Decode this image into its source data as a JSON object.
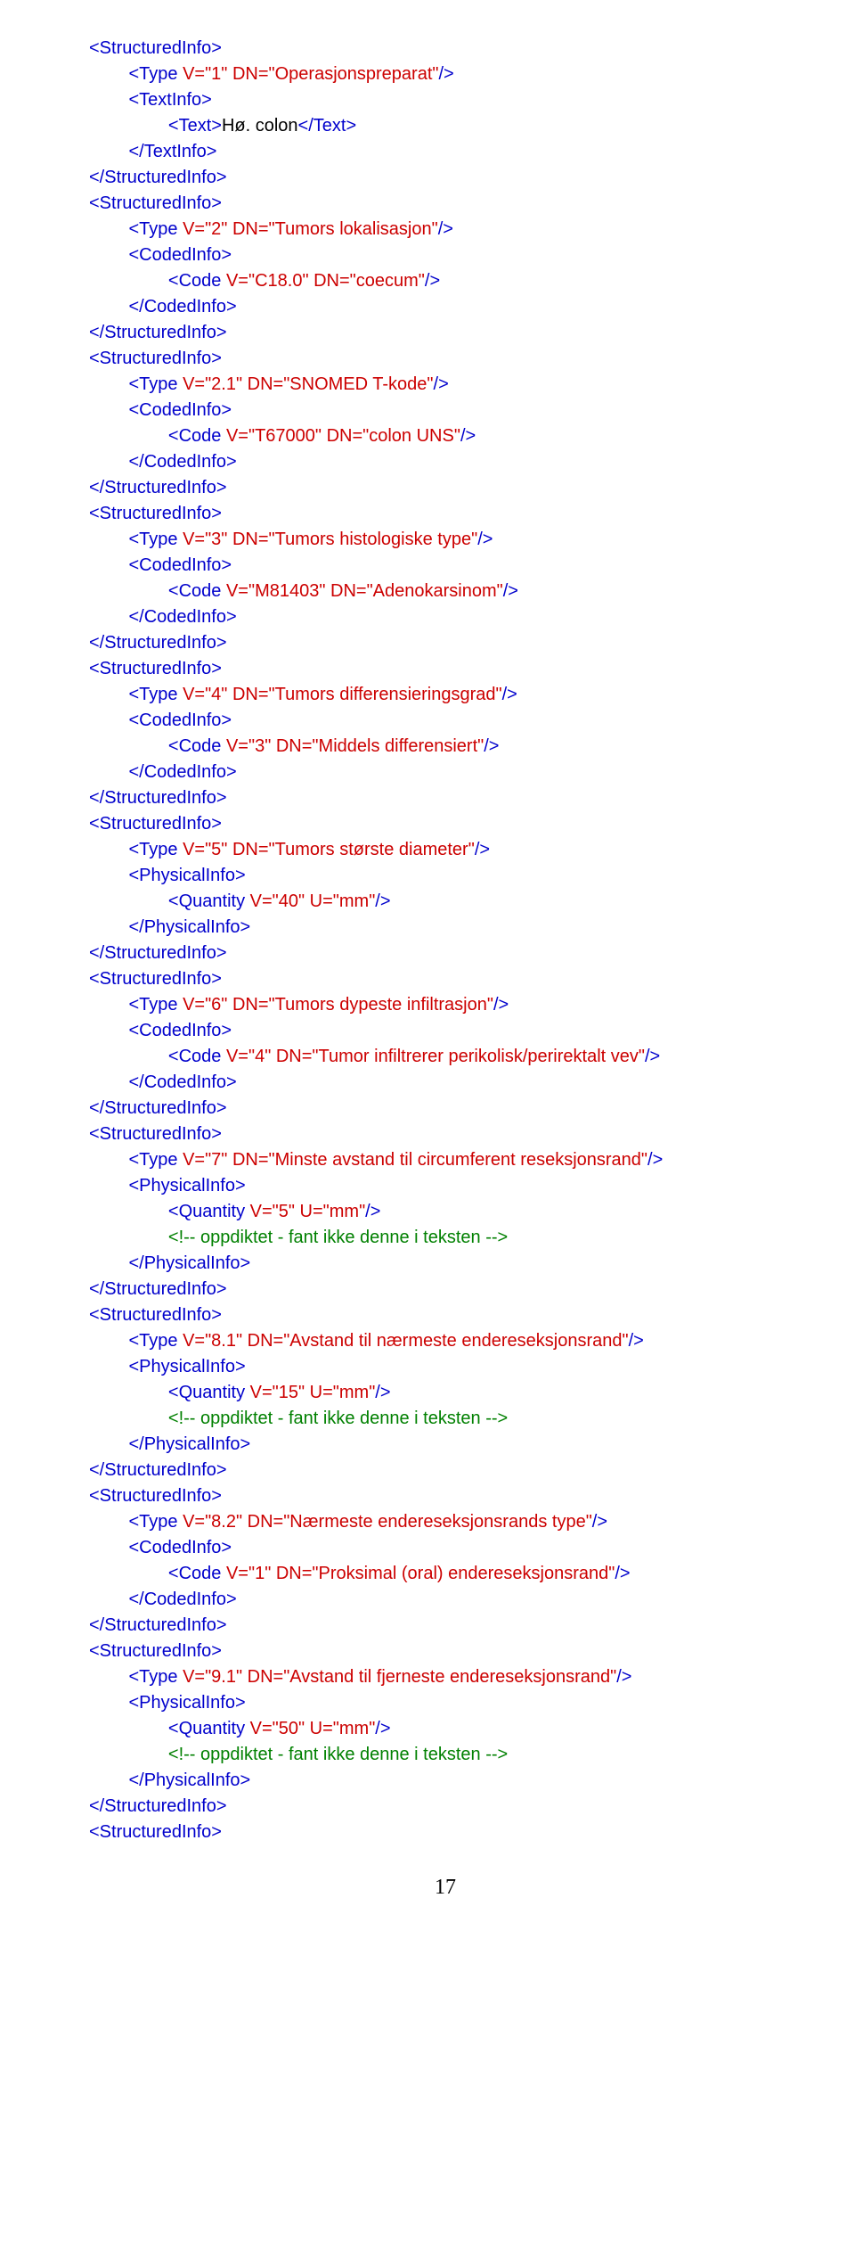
{
  "page_number": "17",
  "lines": [
    {
      "indent": 0,
      "segs": [
        {
          "t": "tag",
          "s": "<StructuredInfo>"
        }
      ]
    },
    {
      "indent": 1,
      "segs": [
        {
          "t": "tag",
          "s": "<Type "
        },
        {
          "t": "attr",
          "s": "V=\"1\" DN=\"Operasjonspreparat\""
        },
        {
          "t": "tag",
          "s": "/>"
        }
      ]
    },
    {
      "indent": 1,
      "segs": [
        {
          "t": "tag",
          "s": "<TextInfo>"
        }
      ]
    },
    {
      "indent": 2,
      "segs": [
        {
          "t": "tag",
          "s": "<Text>"
        },
        {
          "t": "txt",
          "s": "Hø. colon"
        },
        {
          "t": "tag",
          "s": "</Text>"
        }
      ]
    },
    {
      "indent": 1,
      "segs": [
        {
          "t": "tag",
          "s": "</TextInfo>"
        }
      ]
    },
    {
      "indent": 0,
      "segs": [
        {
          "t": "tag",
          "s": "</StructuredInfo>"
        }
      ]
    },
    {
      "indent": 0,
      "segs": [
        {
          "t": "tag",
          "s": "<StructuredInfo>"
        }
      ]
    },
    {
      "indent": 1,
      "segs": [
        {
          "t": "tag",
          "s": "<Type "
        },
        {
          "t": "attr",
          "s": "V=\"2\" DN=\"Tumors lokalisasjon\""
        },
        {
          "t": "tag",
          "s": "/>"
        }
      ]
    },
    {
      "indent": 1,
      "segs": [
        {
          "t": "tag",
          "s": "<CodedInfo>"
        }
      ]
    },
    {
      "indent": 2,
      "segs": [
        {
          "t": "tag",
          "s": "<Code "
        },
        {
          "t": "attr",
          "s": "V=\"C18.0\" DN=\"coecum\""
        },
        {
          "t": "tag",
          "s": "/>"
        }
      ]
    },
    {
      "indent": 1,
      "segs": [
        {
          "t": "tag",
          "s": "</CodedInfo>"
        }
      ]
    },
    {
      "indent": 0,
      "segs": [
        {
          "t": "tag",
          "s": "</StructuredInfo>"
        }
      ]
    },
    {
      "indent": 0,
      "segs": [
        {
          "t": "tag",
          "s": "<StructuredInfo>"
        }
      ]
    },
    {
      "indent": 1,
      "segs": [
        {
          "t": "tag",
          "s": "<Type "
        },
        {
          "t": "attr",
          "s": "V=\"2.1\" DN=\"SNOMED T-kode\""
        },
        {
          "t": "tag",
          "s": "/>"
        }
      ]
    },
    {
      "indent": 1,
      "segs": [
        {
          "t": "tag",
          "s": "<CodedInfo>"
        }
      ]
    },
    {
      "indent": 2,
      "segs": [
        {
          "t": "tag",
          "s": "<Code "
        },
        {
          "t": "attr",
          "s": "V=\"T67000\" DN=\"colon UNS\""
        },
        {
          "t": "tag",
          "s": "/>"
        }
      ]
    },
    {
      "indent": 1,
      "segs": [
        {
          "t": "tag",
          "s": "</CodedInfo>"
        }
      ]
    },
    {
      "indent": 0,
      "segs": [
        {
          "t": "tag",
          "s": "</StructuredInfo>"
        }
      ]
    },
    {
      "indent": 0,
      "segs": [
        {
          "t": "tag",
          "s": "<StructuredInfo>"
        }
      ]
    },
    {
      "indent": 1,
      "segs": [
        {
          "t": "tag",
          "s": "<Type "
        },
        {
          "t": "attr",
          "s": "V=\"3\" DN=\"Tumors histologiske type\""
        },
        {
          "t": "tag",
          "s": "/>"
        }
      ]
    },
    {
      "indent": 1,
      "segs": [
        {
          "t": "tag",
          "s": "<CodedInfo>"
        }
      ]
    },
    {
      "indent": 2,
      "segs": [
        {
          "t": "tag",
          "s": "<Code "
        },
        {
          "t": "attr",
          "s": "V=\"M81403\" DN=\"Adenokarsinom\""
        },
        {
          "t": "tag",
          "s": "/>"
        }
      ]
    },
    {
      "indent": 1,
      "segs": [
        {
          "t": "tag",
          "s": "</CodedInfo>"
        }
      ]
    },
    {
      "indent": 0,
      "segs": [
        {
          "t": "tag",
          "s": "</StructuredInfo>"
        }
      ]
    },
    {
      "indent": 0,
      "segs": [
        {
          "t": "tag",
          "s": "<StructuredInfo>"
        }
      ]
    },
    {
      "indent": 1,
      "segs": [
        {
          "t": "tag",
          "s": "<Type "
        },
        {
          "t": "attr",
          "s": "V=\"4\" DN=\"Tumors differensieringsgrad\""
        },
        {
          "t": "tag",
          "s": "/>"
        }
      ]
    },
    {
      "indent": 1,
      "segs": [
        {
          "t": "tag",
          "s": "<CodedInfo>"
        }
      ]
    },
    {
      "indent": 2,
      "segs": [
        {
          "t": "tag",
          "s": "<Code "
        },
        {
          "t": "attr",
          "s": "V=\"3\" DN=\"Middels differensiert\""
        },
        {
          "t": "tag",
          "s": "/>"
        }
      ]
    },
    {
      "indent": 1,
      "segs": [
        {
          "t": "tag",
          "s": "</CodedInfo>"
        }
      ]
    },
    {
      "indent": 0,
      "segs": [
        {
          "t": "tag",
          "s": "</StructuredInfo>"
        }
      ]
    },
    {
      "indent": 0,
      "segs": [
        {
          "t": "tag",
          "s": "<StructuredInfo>"
        }
      ]
    },
    {
      "indent": 1,
      "segs": [
        {
          "t": "tag",
          "s": "<Type "
        },
        {
          "t": "attr",
          "s": "V=\"5\" DN=\"Tumors største diameter\""
        },
        {
          "t": "tag",
          "s": "/>"
        }
      ]
    },
    {
      "indent": 1,
      "segs": [
        {
          "t": "tag",
          "s": "<PhysicalInfo>"
        }
      ]
    },
    {
      "indent": 2,
      "segs": [
        {
          "t": "tag",
          "s": "<Quantity "
        },
        {
          "t": "attr",
          "s": "V=\"40\" U=\"mm\""
        },
        {
          "t": "tag",
          "s": "/>"
        }
      ]
    },
    {
      "indent": 1,
      "segs": [
        {
          "t": "tag",
          "s": "</PhysicalInfo>"
        }
      ]
    },
    {
      "indent": 0,
      "segs": [
        {
          "t": "tag",
          "s": "</StructuredInfo>"
        }
      ]
    },
    {
      "indent": 0,
      "segs": [
        {
          "t": "tag",
          "s": "<StructuredInfo>"
        }
      ]
    },
    {
      "indent": 1,
      "segs": [
        {
          "t": "tag",
          "s": "<Type "
        },
        {
          "t": "attr",
          "s": "V=\"6\" DN=\"Tumors dypeste infiltrasjon\""
        },
        {
          "t": "tag",
          "s": "/>"
        }
      ]
    },
    {
      "indent": 1,
      "segs": [
        {
          "t": "tag",
          "s": "<CodedInfo>"
        }
      ]
    },
    {
      "indent": 2,
      "segs": [
        {
          "t": "tag",
          "s": "<Code "
        },
        {
          "t": "attr",
          "s": "V=\"4\" DN=\"Tumor infiltrerer perikolisk/perirektalt vev\""
        },
        {
          "t": "tag",
          "s": "/>"
        }
      ]
    },
    {
      "indent": 1,
      "segs": [
        {
          "t": "tag",
          "s": "</CodedInfo>"
        }
      ]
    },
    {
      "indent": 0,
      "segs": [
        {
          "t": "tag",
          "s": "</StructuredInfo>"
        }
      ]
    },
    {
      "indent": 0,
      "segs": [
        {
          "t": "tag",
          "s": "<StructuredInfo>"
        }
      ]
    },
    {
      "indent": 1,
      "segs": [
        {
          "t": "tag",
          "s": "<Type "
        },
        {
          "t": "attr",
          "s": "V=\"7\" DN=\"Minste avstand til circumferent reseksjonsrand\""
        },
        {
          "t": "tag",
          "s": "/>"
        }
      ]
    },
    {
      "indent": 1,
      "segs": [
        {
          "t": "tag",
          "s": "<PhysicalInfo>"
        }
      ]
    },
    {
      "indent": 2,
      "segs": [
        {
          "t": "tag",
          "s": "<Quantity "
        },
        {
          "t": "attr",
          "s": "V=\"5\" U=\"mm\""
        },
        {
          "t": "tag",
          "s": "/>"
        }
      ]
    },
    {
      "indent": 2,
      "segs": [
        {
          "t": "comment",
          "s": "<!-- oppdiktet - fant ikke denne i teksten -->"
        }
      ]
    },
    {
      "indent": 1,
      "segs": [
        {
          "t": "tag",
          "s": "</PhysicalInfo>"
        }
      ]
    },
    {
      "indent": 0,
      "segs": [
        {
          "t": "tag",
          "s": "</StructuredInfo>"
        }
      ]
    },
    {
      "indent": 0,
      "segs": [
        {
          "t": "tag",
          "s": "<StructuredInfo>"
        }
      ]
    },
    {
      "indent": 1,
      "segs": [
        {
          "t": "tag",
          "s": "<Type "
        },
        {
          "t": "attr",
          "s": "V=\"8.1\" DN=\"Avstand til nærmeste endereseksjonsrand\""
        },
        {
          "t": "tag",
          "s": "/>"
        }
      ]
    },
    {
      "indent": 1,
      "segs": [
        {
          "t": "tag",
          "s": "<PhysicalInfo>"
        }
      ]
    },
    {
      "indent": 2,
      "segs": [
        {
          "t": "tag",
          "s": "<Quantity "
        },
        {
          "t": "attr",
          "s": "V=\"15\" U=\"mm\""
        },
        {
          "t": "tag",
          "s": "/>"
        }
      ]
    },
    {
      "indent": 2,
      "segs": [
        {
          "t": "comment",
          "s": "<!-- oppdiktet - fant ikke denne i teksten -->"
        }
      ]
    },
    {
      "indent": 1,
      "segs": [
        {
          "t": "tag",
          "s": "</PhysicalInfo>"
        }
      ]
    },
    {
      "indent": 0,
      "segs": [
        {
          "t": "tag",
          "s": "</StructuredInfo>"
        }
      ]
    },
    {
      "indent": 0,
      "segs": [
        {
          "t": "tag",
          "s": "<StructuredInfo>"
        }
      ]
    },
    {
      "indent": 1,
      "segs": [
        {
          "t": "tag",
          "s": "<Type "
        },
        {
          "t": "attr",
          "s": "V=\"8.2\" DN=\"Nærmeste endereseksjonsrands type\""
        },
        {
          "t": "tag",
          "s": "/>"
        }
      ]
    },
    {
      "indent": 1,
      "segs": [
        {
          "t": "tag",
          "s": "<CodedInfo>"
        }
      ]
    },
    {
      "indent": 2,
      "segs": [
        {
          "t": "tag",
          "s": "<Code "
        },
        {
          "t": "attr",
          "s": "V=\"1\" DN=\"Proksimal (oral) endereseksjonsrand\""
        },
        {
          "t": "tag",
          "s": "/>"
        }
      ]
    },
    {
      "indent": 1,
      "segs": [
        {
          "t": "tag",
          "s": "</CodedInfo>"
        }
      ]
    },
    {
      "indent": 0,
      "segs": [
        {
          "t": "tag",
          "s": "</StructuredInfo>"
        }
      ]
    },
    {
      "indent": 0,
      "segs": [
        {
          "t": "tag",
          "s": "<StructuredInfo>"
        }
      ]
    },
    {
      "indent": 1,
      "segs": [
        {
          "t": "tag",
          "s": "<Type "
        },
        {
          "t": "attr",
          "s": "V=\"9.1\" DN=\"Avstand til fjerneste endereseksjonsrand\""
        },
        {
          "t": "tag",
          "s": "/>"
        }
      ]
    },
    {
      "indent": 1,
      "segs": [
        {
          "t": "tag",
          "s": "<PhysicalInfo>"
        }
      ]
    },
    {
      "indent": 2,
      "segs": [
        {
          "t": "tag",
          "s": "<Quantity "
        },
        {
          "t": "attr",
          "s": "V=\"50\" U=\"mm\""
        },
        {
          "t": "tag",
          "s": "/>"
        }
      ]
    },
    {
      "indent": 2,
      "segs": [
        {
          "t": "comment",
          "s": "<!-- oppdiktet - fant ikke denne i teksten -->"
        }
      ]
    },
    {
      "indent": 1,
      "segs": [
        {
          "t": "tag",
          "s": "</PhysicalInfo>"
        }
      ]
    },
    {
      "indent": 0,
      "segs": [
        {
          "t": "tag",
          "s": "</StructuredInfo>"
        }
      ]
    },
    {
      "indent": 0,
      "segs": [
        {
          "t": "tag",
          "s": "<StructuredInfo>"
        }
      ]
    }
  ]
}
